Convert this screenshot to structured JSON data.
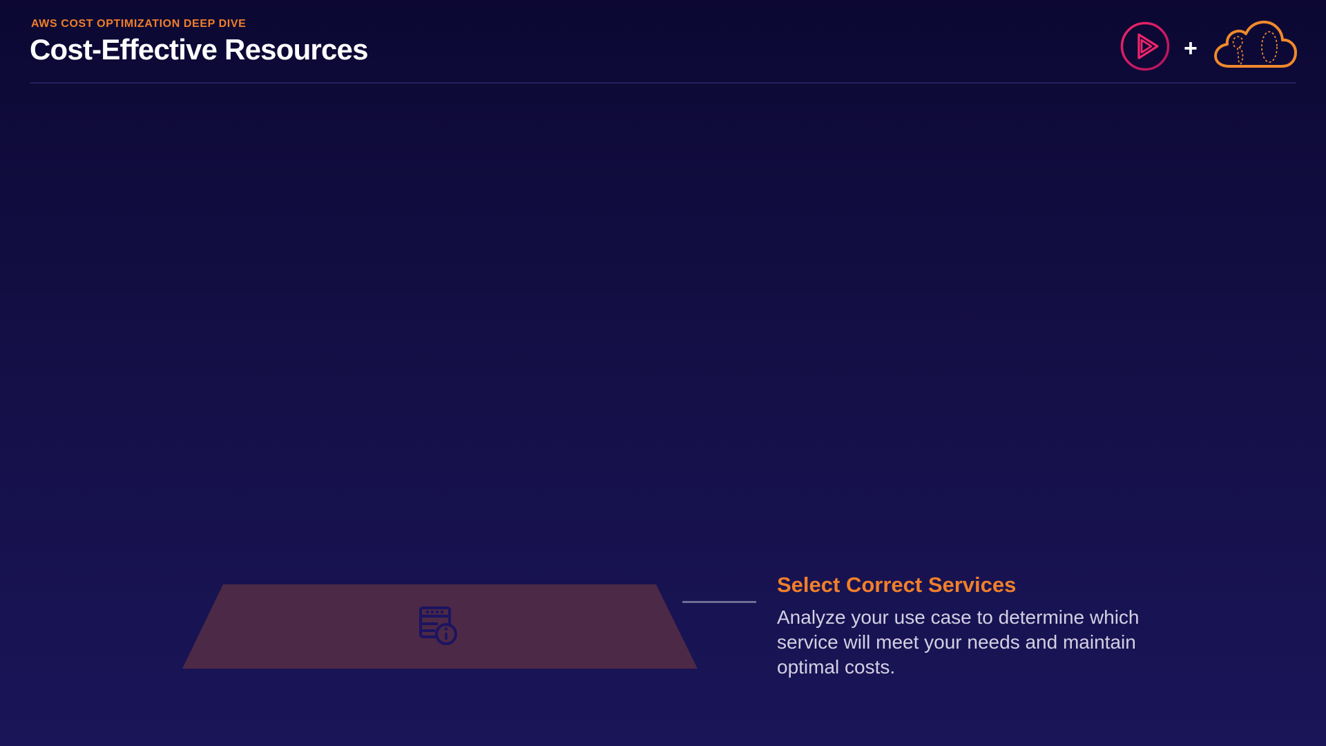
{
  "header": {
    "eyebrow": "AWS COST OPTIMIZATION DEEP DIVE",
    "title": "Cost-Effective Resources"
  },
  "logos": {
    "plus": "+",
    "play_icon": "pluralsight-play-icon",
    "cloud_icon": "acloudguru-cloud-icon"
  },
  "pyramid": {
    "step_icon": "server-info-icon"
  },
  "step": {
    "heading": "Select Correct Services",
    "body": "Analyze your use case to determine which service will meet your needs and maintain optimal costs."
  },
  "colors": {
    "accent": "#f07f2a",
    "pink": "#e2246a",
    "pyramid_fill": "#4c2946",
    "pyramid_icon": "#1b1460",
    "title": "#ffffff",
    "body": "#d4d0e3"
  }
}
